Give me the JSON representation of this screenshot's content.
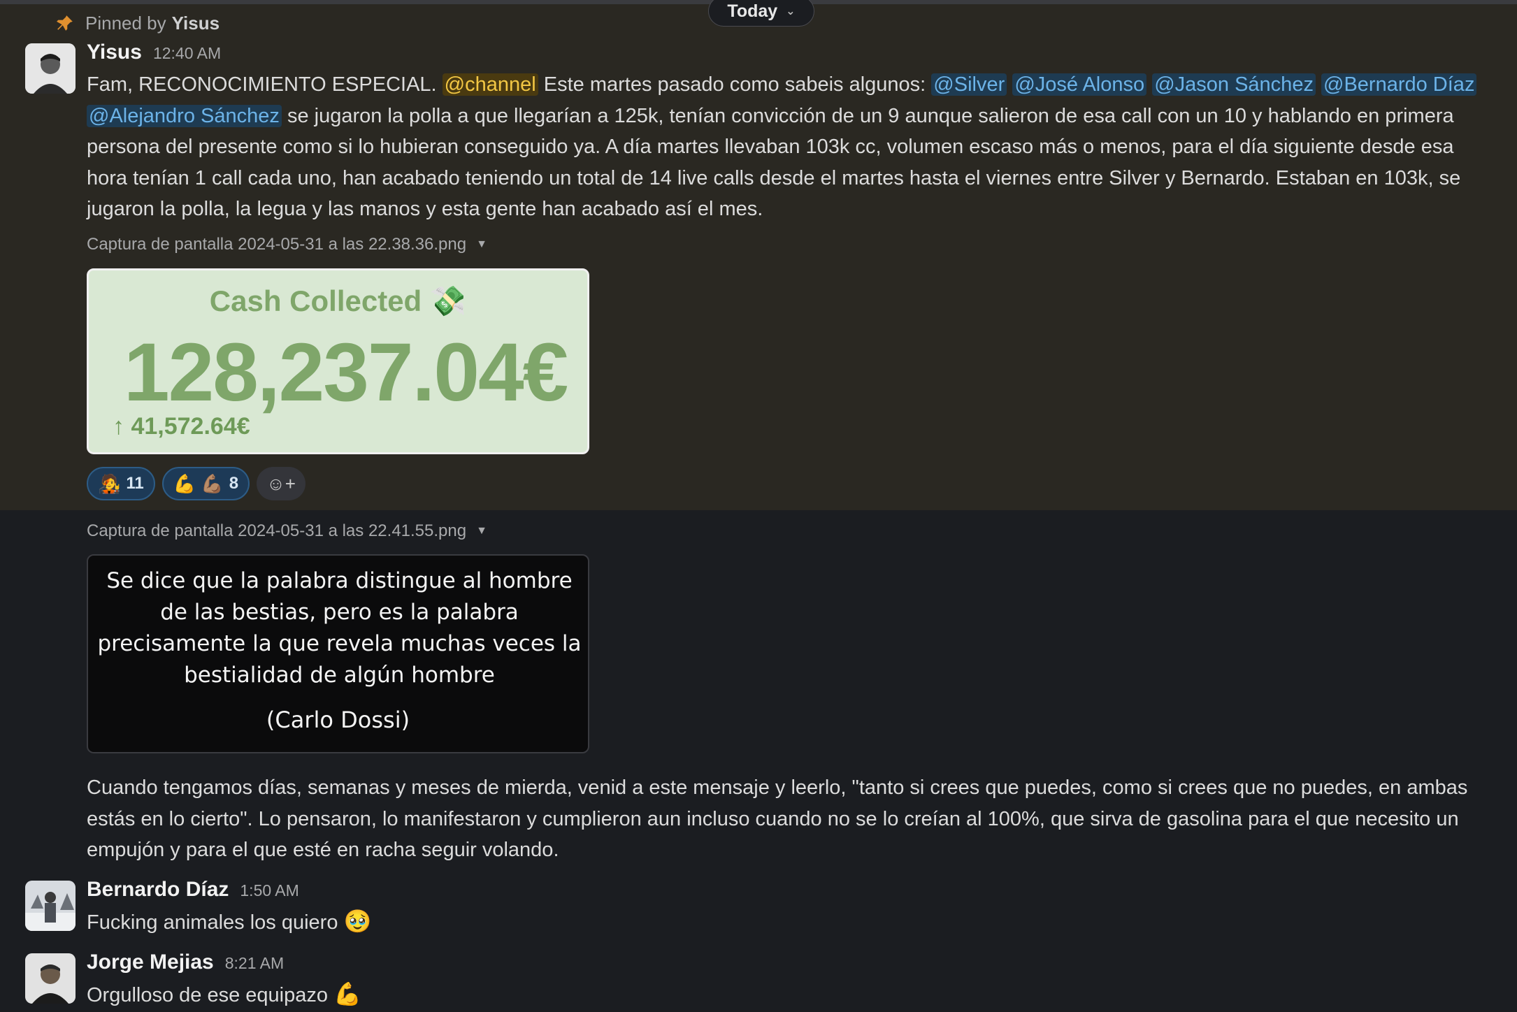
{
  "day_divider": {
    "label": "Today"
  },
  "pinned": {
    "prefix": "Pinned by",
    "by": "Yisus"
  },
  "messages": [
    {
      "author": "Yisus",
      "time": "12:40 AM",
      "text_parts": {
        "p1": "Fam, RECONOCIMIENTO ESPECIAL. ",
        "channel": "@channel",
        "p2": " Este martes pasado como sabeis algunos: ",
        "m1": "@Silver",
        "m2": "@José Alonso",
        "m3": "@Jason Sánchez",
        "m4": "@Bernardo Díaz",
        "m5": "@Alejandro Sánchez",
        "p3": " se jugaron la polla a que llegarían a 125k, tenían convicción de un 9 aunque salieron de esa call con un 10 y hablando en primera persona del presente como si lo hubieran conseguido ya. A día martes llevaban 103k cc, volumen escaso más o menos, para el día siguiente desde esa hora tenían 1 call cada uno, han acabado teniendo un total de 14 live calls desde el martes hasta el viernes entre Silver y Bernardo. Estaban en 103k, se jugaron la polla, la legua y las manos y esta gente han acabado así el mes."
      },
      "attachment1": {
        "filename": "Captura de pantalla 2024-05-31 a las 22.38.36.png",
        "title": "Cash Collected 💸",
        "value": "128,237.04€",
        "delta": "↑ 41,572.64€"
      },
      "reactions": [
        {
          "emoji": "🧑‍🎤",
          "count": "11"
        },
        {
          "emoji": "💪 💪🏽",
          "count": "8"
        }
      ],
      "add_reaction_icon": "☺+",
      "attachment2": {
        "filename": "Captura de pantalla 2024-05-31 a las 22.41.55.png",
        "quote": "Se dice que la palabra distingue al hombre de las bestias, pero es la palabra precisamente la que revela muchas veces la bestialidad de algún hombre",
        "quote_author": "(Carlo Dossi)"
      },
      "followup": "Cuando tengamos días, semanas y meses de mierda, venid a este mensaje y leerlo, \"tanto si crees que puedes, como si crees que no puedes, en ambas estás en lo cierto\". Lo pensaron, lo manifestaron y cumplieron aun incluso cuando no se lo creían al 100%, que sirva de gasolina para el que necesito un empujón y para el que esté en racha seguir volando."
    },
    {
      "author": "Bernardo Díaz",
      "time": "1:50 AM",
      "text": "Fucking animales los quiero",
      "emoji": "🥹"
    },
    {
      "author": "Jorge Mejias",
      "time": "8:21 AM",
      "text": "Orgulloso de ese equipazo",
      "emoji": "💪"
    }
  ],
  "colors": {
    "background": "#1b1d21",
    "pinned_background": "#2a2822",
    "mention_text": "#6cb3e8",
    "channel_mention_text": "#f2c744",
    "cash_green": "#7fa66a"
  }
}
